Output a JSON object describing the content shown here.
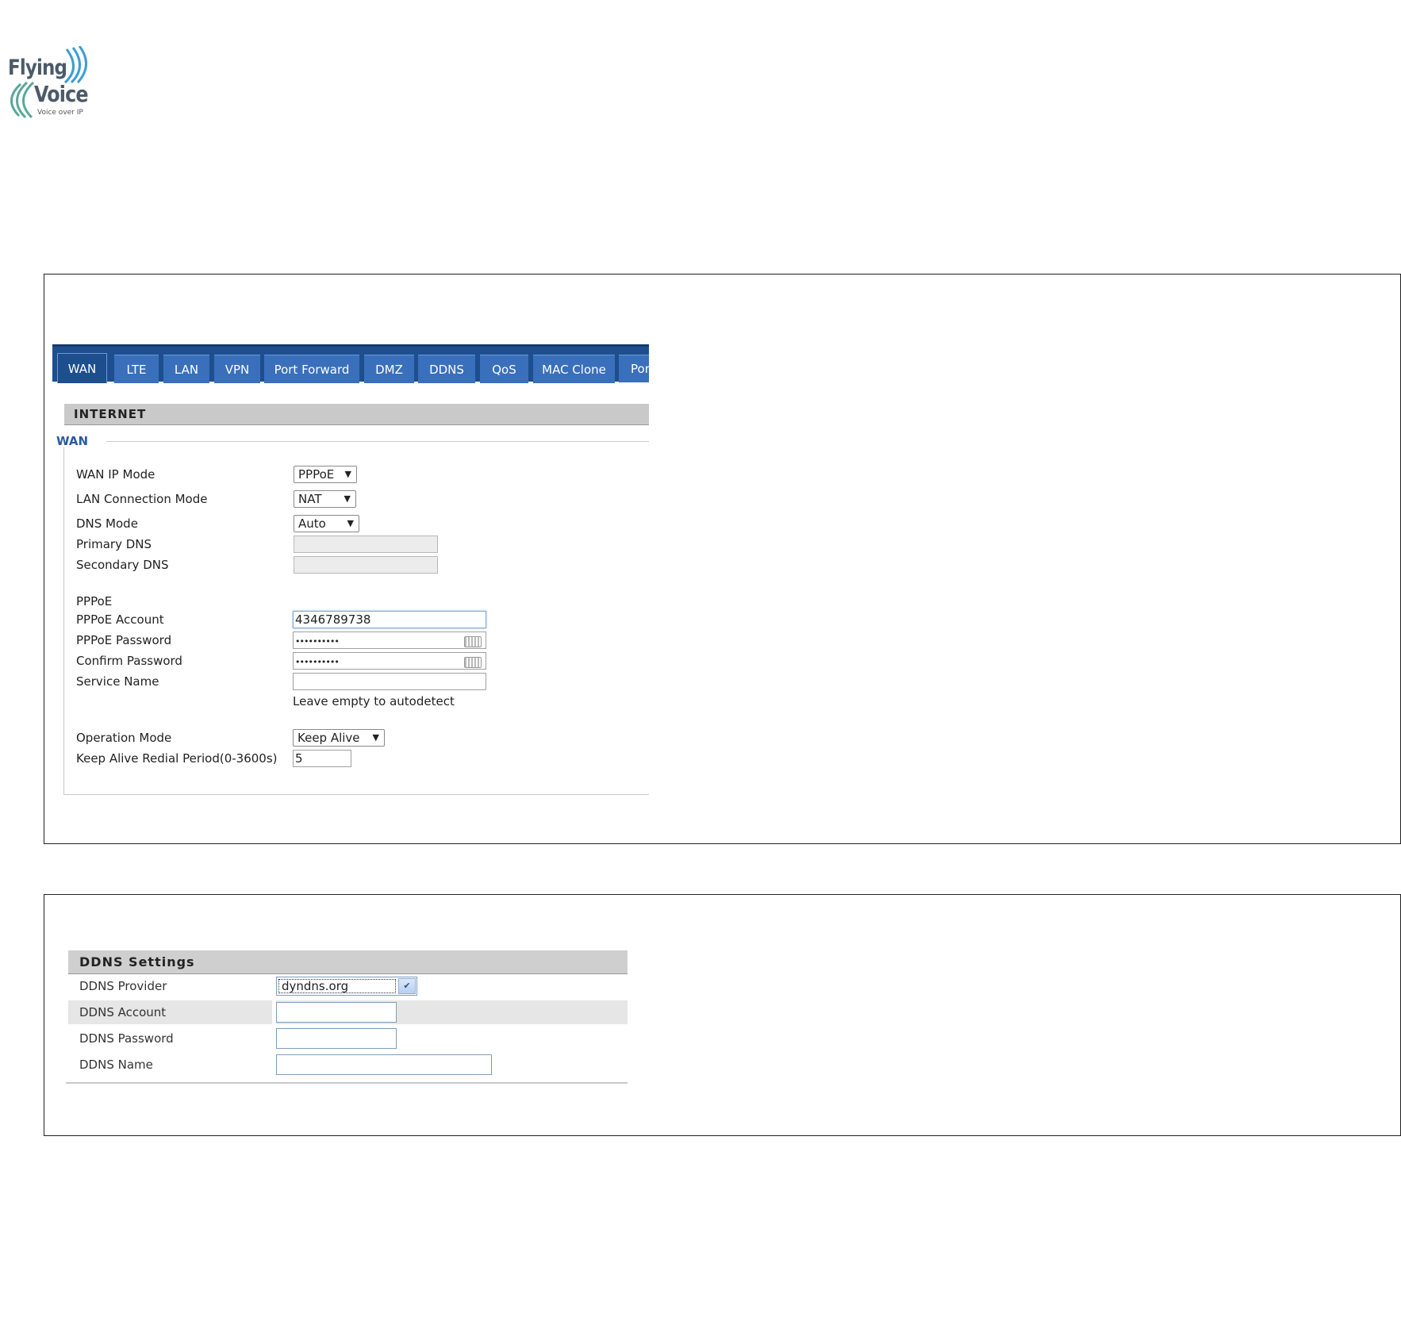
{
  "logo": {
    "line1": "Flying",
    "line2": "Voice",
    "tagline": "Voice over IP"
  },
  "wan_screenshot": {
    "tabs": [
      {
        "label": "WAN",
        "active": true
      },
      {
        "label": "LTE"
      },
      {
        "label": "LAN"
      },
      {
        "label": "VPN"
      },
      {
        "label": "Port Forward"
      },
      {
        "label": "DMZ"
      },
      {
        "label": "DDNS"
      },
      {
        "label": "QoS"
      },
      {
        "label": "MAC Clone"
      },
      {
        "label": "Port"
      }
    ],
    "section_title": "INTERNET",
    "group_title": "WAN",
    "fields": {
      "wan_ip_mode": {
        "label": "WAN IP Mode",
        "value": "PPPoE"
      },
      "lan_connection_mode": {
        "label": "LAN Connection Mode",
        "value": "NAT"
      },
      "dns_mode": {
        "label": "DNS Mode",
        "value": "Auto"
      },
      "primary_dns": {
        "label": "Primary DNS",
        "value": ""
      },
      "secondary_dns": {
        "label": "Secondary DNS",
        "value": ""
      },
      "pppoe_heading": "PPPoE",
      "pppoe_account": {
        "label": "PPPoE Account",
        "value": "4346789738"
      },
      "pppoe_password": {
        "label": "PPPoE Password",
        "value": "••••••••••"
      },
      "confirm_password": {
        "label": "Confirm Password",
        "value": "••••••••••"
      },
      "service_name": {
        "label": "Service Name",
        "value": "",
        "hint": "Leave empty to autodetect"
      },
      "operation_mode": {
        "label": "Operation Mode",
        "value": "Keep Alive"
      },
      "keep_alive_period": {
        "label": "Keep Alive Redial Period(0-3600s)",
        "value": "5"
      }
    }
  },
  "ddns_screenshot": {
    "title": "DDNS Settings",
    "provider": {
      "label": "DDNS Provider",
      "value": "dyndns.org"
    },
    "account": {
      "label": "DDNS Account",
      "value": ""
    },
    "password": {
      "label": "DDNS Password",
      "value": ""
    },
    "name": {
      "label": "DDNS Name",
      "value": ""
    }
  }
}
